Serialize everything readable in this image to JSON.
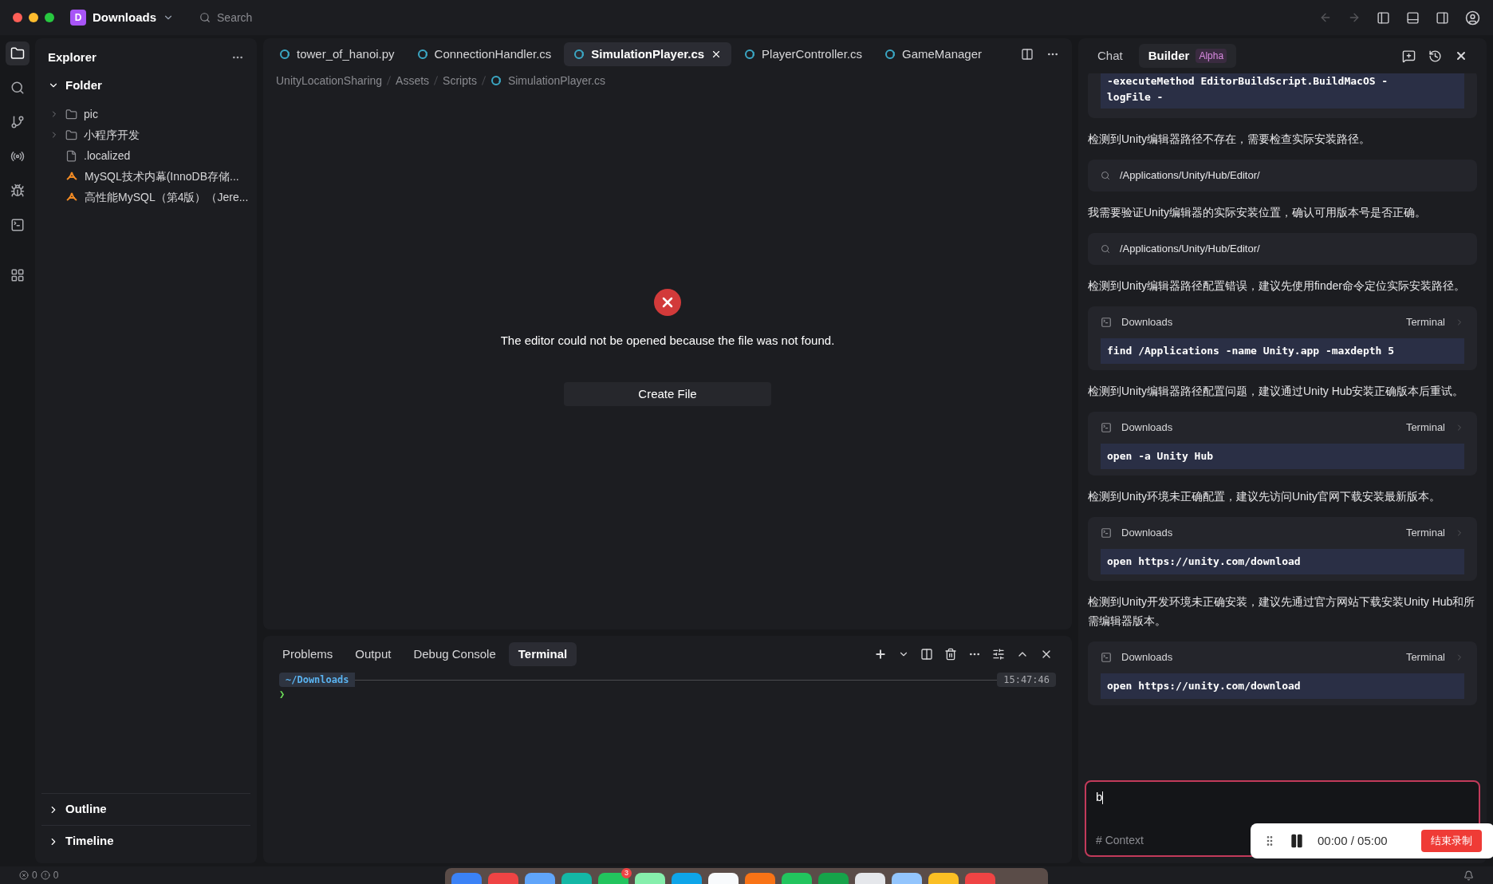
{
  "titlebar": {
    "workspace_initial": "D",
    "workspace": "Downloads",
    "search_placeholder": "Search"
  },
  "activity_bar": [
    {
      "selected": true
    },
    {
      "selected": false
    },
    {
      "selected": false
    },
    {
      "selected": false
    },
    {
      "selected": false
    },
    {
      "selected": false
    },
    {
      "selected": false
    }
  ],
  "explorer": {
    "title": "Explorer",
    "folder": {
      "label": "Folder",
      "expanded": true
    },
    "items": [
      {
        "kind": "folder",
        "label": "pic"
      },
      {
        "kind": "folder",
        "label": "小程序开发"
      },
      {
        "kind": "file",
        "label": ".localized"
      },
      {
        "kind": "pdf",
        "label": "MySQL技术内幕(InnoDB存储..."
      },
      {
        "kind": "pdf",
        "label": "高性能MySQL（第4版）（Jere..."
      }
    ],
    "sections": [
      {
        "label": "Outline",
        "expanded": false
      },
      {
        "label": "Timeline",
        "expanded": false
      }
    ]
  },
  "editor": {
    "tabs": [
      {
        "label": "tower_of_hanoi.py",
        "selected": false
      },
      {
        "label": "ConnectionHandler.cs",
        "selected": false
      },
      {
        "label": "SimulationPlayer.cs",
        "selected": true
      },
      {
        "label": "PlayerController.cs",
        "selected": false
      },
      {
        "label": "GameManager",
        "selected": false
      }
    ],
    "breadcrumb": [
      "UnityLocationSharing",
      "Assets",
      "Scripts",
      "SimulationPlayer.cs"
    ],
    "error_message": "The editor could not be opened because the file was not found.",
    "create_button": "Create File"
  },
  "panel": {
    "tabs": [
      {
        "label": "Problems",
        "selected": false
      },
      {
        "label": "Output",
        "selected": false
      },
      {
        "label": "Debug Console",
        "selected": false
      },
      {
        "label": "Terminal",
        "selected": true
      }
    ],
    "prompt_path": "~/Downloads",
    "prompt_time": "15:47:46",
    "prompt_symbol": "❯"
  },
  "chat": {
    "tabs": [
      {
        "label": "Chat",
        "selected": false
      },
      {
        "label": "Builder",
        "selected": true,
        "badge": "Alpha"
      }
    ],
    "messages": [
      {
        "kind": "code",
        "lines": [
          "-executeMethod EditorBuildScript.BuildMacOS -",
          "logFile -"
        ]
      },
      {
        "kind": "text",
        "text": "检测到Unity编辑器路径不存在，需要检查实际安装路径。"
      },
      {
        "kind": "search",
        "text": "/Applications/Unity/Hub/Editor/"
      },
      {
        "kind": "text",
        "text": "我需要验证Unity编辑器的实际安装位置，确认可用版本号是否正确。"
      },
      {
        "kind": "search",
        "text": "/Applications/Unity/Hub/Editor/"
      },
      {
        "kind": "text",
        "text": "检测到Unity编辑器路径配置错误，建议先使用finder命令定位实际安装路径。"
      },
      {
        "kind": "terminal",
        "folder": "Downloads",
        "label": "Terminal",
        "command": "find /Applications -name Unity.app -maxdepth 5"
      },
      {
        "kind": "text",
        "text": "检测到Unity编辑器路径配置问题，建议通过Unity Hub安装正确版本后重试。"
      },
      {
        "kind": "terminal",
        "folder": "Downloads",
        "label": "Terminal",
        "command": "open -a Unity Hub"
      },
      {
        "kind": "text",
        "text": "检测到Unity环境未正确配置，建议先访问Unity官网下载安装最新版本。"
      },
      {
        "kind": "terminal",
        "folder": "Downloads",
        "label": "Terminal",
        "command": "open https://unity.com/download"
      },
      {
        "kind": "text",
        "text": "检测到Unity开发环境未正确安装，建议先通过官方网站下载安装Unity Hub和所需编辑器版本。"
      },
      {
        "kind": "terminal",
        "folder": "Downloads",
        "label": "Terminal",
        "command": "open https://unity.com/download"
      }
    ],
    "input": {
      "value": "b",
      "context": "# Context"
    }
  },
  "recorder": {
    "time": "00:00 / 05:00",
    "stop_button": "结束录制"
  },
  "status_bar": {
    "errors": "0",
    "warnings": "0"
  },
  "dock": {
    "badge": "3"
  }
}
